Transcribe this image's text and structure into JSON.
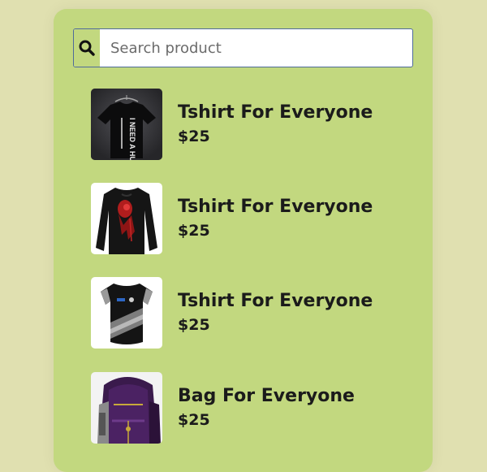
{
  "search": {
    "placeholder": "Search product",
    "value": "",
    "icon": "search-icon"
  },
  "products": [
    {
      "name": "Tshirt For Everyone",
      "price": "$25",
      "image": "black-tshirt-i-need-a-hug",
      "shirt_text": "I NEED A HUG"
    },
    {
      "name": "Tshirt For Everyone",
      "price": "$25",
      "image": "black-longsleeve-red-print"
    },
    {
      "name": "Tshirt For Everyone",
      "price": "$25",
      "image": "black-grey-sports-jersey"
    },
    {
      "name": "Bag For Everyone",
      "price": "$25",
      "image": "purple-backpack"
    }
  ],
  "colors": {
    "page_background": "#e0e0b0",
    "panel_background": "#c2d87f",
    "text": "#1b1b1b"
  }
}
